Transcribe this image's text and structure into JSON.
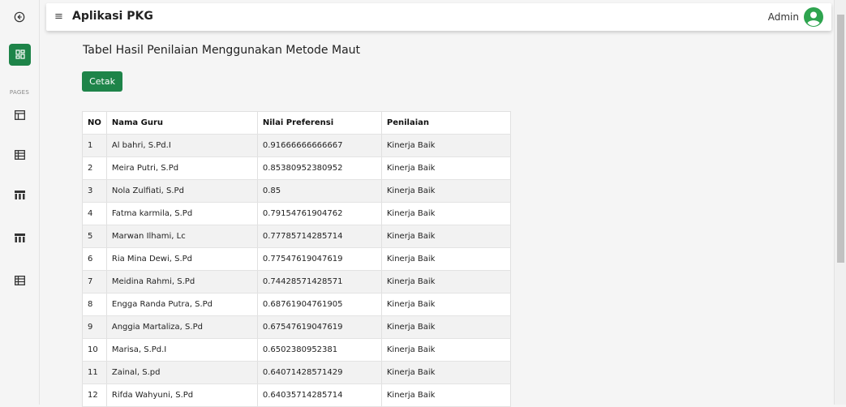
{
  "app": {
    "title": "Aplikasi PKG",
    "user": "Admin"
  },
  "sidebar": {
    "section_label": "PAGES",
    "items": [
      {
        "icon": "back-circle-icon"
      },
      {
        "icon": "dashboard-icon",
        "active": true
      },
      {
        "icon": "table-icon"
      },
      {
        "icon": "table-icon"
      },
      {
        "icon": "table-columns-icon"
      },
      {
        "icon": "table-columns-icon"
      },
      {
        "icon": "table-icon"
      }
    ]
  },
  "main": {
    "heading": "Tabel Hasil Penilaian Menggunakan Metode Maut",
    "print_button": "Cetak",
    "table": {
      "headers": [
        "NO",
        "Nama Guru",
        "Nilai Preferensi",
        "Penilaian"
      ],
      "rows": [
        [
          "1",
          "Al bahri, S.Pd.I",
          "0.91666666666667",
          "Kinerja Baik"
        ],
        [
          "2",
          "Meira Putri, S.Pd",
          "0.85380952380952",
          "Kinerja Baik"
        ],
        [
          "3",
          "Nola Zulfiati, S.Pd",
          "0.85",
          "Kinerja Baik"
        ],
        [
          "4",
          "Fatma karmila, S.Pd",
          "0.79154761904762",
          "Kinerja Baik"
        ],
        [
          "5",
          "Marwan Ilhami, Lc",
          "0.77785714285714",
          "Kinerja Baik"
        ],
        [
          "6",
          "Ria Mina Dewi, S.Pd",
          "0.77547619047619",
          "Kinerja Baik"
        ],
        [
          "7",
          "Meidina Rahmi, S.Pd",
          "0.74428571428571",
          "Kinerja Baik"
        ],
        [
          "8",
          "Engga Randa Putra, S.Pd",
          "0.68761904761905",
          "Kinerja Baik"
        ],
        [
          "9",
          "Anggia Martaliza, S.Pd",
          "0.67547619047619",
          "Kinerja Baik"
        ],
        [
          "10",
          "Marisa, S.Pd.I",
          "0.6502380952381",
          "Kinerja Baik"
        ],
        [
          "11",
          "Zainal, S.pd",
          "0.64071428571429",
          "Kinerja Baik"
        ],
        [
          "12",
          "Rifda Wahyuni, S.Pd",
          "0.64035714285714",
          "Kinerja Baik"
        ]
      ]
    }
  },
  "colors": {
    "accent": "#1e8449",
    "background": "#f5f5f5",
    "avatar": "#2ea44f"
  }
}
